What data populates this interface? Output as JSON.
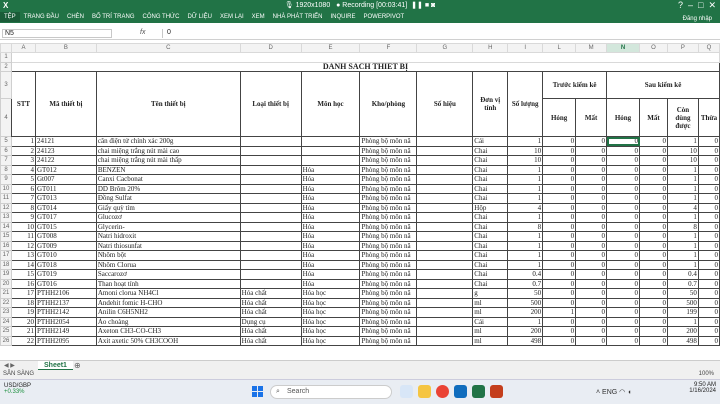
{
  "window": {
    "title": "Recording [00:03:41]",
    "resolution": "1920x1080",
    "app_logo": "X"
  },
  "ribbon": {
    "tabs": [
      "TỆP",
      "TRANG ĐẦU",
      "CHÈN",
      "BỐ TRÍ TRANG",
      "CÔNG THỨC",
      "DỮ LIỆU",
      "XEM LẠI",
      "XEM",
      "NHÀ PHÁT TRIỂN",
      "INQUIRE",
      "POWERPIVOT"
    ],
    "right": "Đăng nhập"
  },
  "formula": {
    "name_box": "N5",
    "fx": "fx",
    "value": "0"
  },
  "columns": [
    "A",
    "B",
    "C",
    "D",
    "E",
    "F",
    "G",
    "H",
    "I",
    "L",
    "M",
    "N",
    "O",
    "P",
    "Q"
  ],
  "selected_column": "N",
  "sheet": {
    "title": "DANH SÁCH THIẾT BỊ",
    "headers": {
      "stt": "STT",
      "code": "Mã thiết bị",
      "name": "Tên thiết bị",
      "type": "Loại thiết bị",
      "subject": "Môn học",
      "store": "Kho/phòng",
      "serial": "Số hiệu",
      "unit": "Đơn vị tính",
      "qty": "Số lượng",
      "before": "Trước kiểm kê",
      "after": "Sau kiểm kê",
      "damaged": "Hỏng",
      "lost": "Mất",
      "usable": "Còn dùng được",
      "excess": "Thừa"
    },
    "rows": [
      {
        "r": "5",
        "stt": "1",
        "code": "24121",
        "name": "cân điện tử chính xác 200g",
        "type": "",
        "subject": "",
        "store": "Phòng bộ môn nă",
        "unit": "Cái",
        "qty": "1",
        "l": "0",
        "m": "0",
        "n": "0",
        "o": "0",
        "p": "1",
        "q": "0"
      },
      {
        "r": "6",
        "stt": "2",
        "code": "24123",
        "name": "chai miệng trắng nút mài cao",
        "type": "",
        "subject": "",
        "store": "Phòng bộ môn nă",
        "unit": "Chai",
        "qty": "10",
        "l": "0",
        "m": "0",
        "n": "0",
        "o": "0",
        "p": "10",
        "q": "0"
      },
      {
        "r": "7",
        "stt": "3",
        "code": "24122",
        "name": "chai miệng trắng nút mài thấp",
        "type": "",
        "subject": "",
        "store": "Phòng bộ môn nă",
        "unit": "Chai",
        "qty": "10",
        "l": "0",
        "m": "0",
        "n": "0",
        "o": "0",
        "p": "10",
        "q": "0"
      },
      {
        "r": "8",
        "stt": "4",
        "code": "GT012",
        "name": "BENZEN",
        "type": "",
        "subject": "Hóa",
        "store": "Phòng bộ môn nă",
        "unit": "Chai",
        "qty": "1",
        "l": "0",
        "m": "0",
        "n": "0",
        "o": "0",
        "p": "1",
        "q": "0"
      },
      {
        "r": "9",
        "stt": "5",
        "code": "Gt007",
        "name": "Canxi Cacbonat",
        "type": "",
        "subject": "Hóa",
        "store": "Phòng bộ môn nă",
        "unit": "Chai",
        "qty": "1",
        "l": "0",
        "m": "0",
        "n": "0",
        "o": "0",
        "p": "1",
        "q": "0"
      },
      {
        "r": "10",
        "stt": "6",
        "code": "GT011",
        "name": "DD Brôm 20%",
        "type": "",
        "subject": "Hóa",
        "store": "Phòng bộ môn nă",
        "unit": "Chai",
        "qty": "1",
        "l": "0",
        "m": "0",
        "n": "0",
        "o": "0",
        "p": "1",
        "q": "0"
      },
      {
        "r": "11",
        "stt": "7",
        "code": "GT013",
        "name": "Đồng Sulfat",
        "type": "",
        "subject": "Hóa",
        "store": "Phòng bộ môn nă",
        "unit": "Chai",
        "qty": "1",
        "l": "0",
        "m": "0",
        "n": "0",
        "o": "0",
        "p": "1",
        "q": "0"
      },
      {
        "r": "12",
        "stt": "8",
        "code": "GT014",
        "name": "Giấy quỳ tím",
        "type": "",
        "subject": "Hóa",
        "store": "Phòng bộ môn nă",
        "unit": "Hộp",
        "qty": "4",
        "l": "0",
        "m": "0",
        "n": "0",
        "o": "0",
        "p": "4",
        "q": "0"
      },
      {
        "r": "13",
        "stt": "9",
        "code": "GT017",
        "name": "Glucozơ",
        "type": "",
        "subject": "Hóa",
        "store": "Phòng bộ môn nă",
        "unit": "Chai",
        "qty": "1",
        "l": "0",
        "m": "0",
        "n": "0",
        "o": "0",
        "p": "1",
        "q": "0"
      },
      {
        "r": "14",
        "stt": "10",
        "code": "GT015",
        "name": "Glycerin-",
        "type": "",
        "subject": "Hóa",
        "store": "Phòng bộ môn nă",
        "unit": "Chai",
        "qty": "8",
        "l": "0",
        "m": "0",
        "n": "0",
        "o": "0",
        "p": "8",
        "q": "0"
      },
      {
        "r": "15",
        "stt": "11",
        "code": "GT008",
        "name": "Natri hidroxit",
        "type": "",
        "subject": "Hóa",
        "store": "Phòng bộ môn nă",
        "unit": "Chai",
        "qty": "1",
        "l": "0",
        "m": "0",
        "n": "0",
        "o": "0",
        "p": "1",
        "q": "0"
      },
      {
        "r": "16",
        "stt": "12",
        "code": "GT009",
        "name": "Natri thiosunfat",
        "type": "",
        "subject": "Hóa",
        "store": "Phòng bộ môn nă",
        "unit": "Chai",
        "qty": "1",
        "l": "0",
        "m": "0",
        "n": "0",
        "o": "0",
        "p": "1",
        "q": "0"
      },
      {
        "r": "17",
        "stt": "13",
        "code": "GT010",
        "name": "Nhôm bột",
        "type": "",
        "subject": "Hóa",
        "store": "Phòng bộ môn nă",
        "unit": "Chai",
        "qty": "1",
        "l": "0",
        "m": "0",
        "n": "0",
        "o": "0",
        "p": "1",
        "q": "0"
      },
      {
        "r": "18",
        "stt": "14",
        "code": "GT018",
        "name": "Nhôm Clorua",
        "type": "",
        "subject": "Hóa",
        "store": "Phòng bộ môn nă",
        "unit": "Chai",
        "qty": "1",
        "l": "0",
        "m": "0",
        "n": "0",
        "o": "0",
        "p": "1",
        "q": "0"
      },
      {
        "r": "19",
        "stt": "15",
        "code": "GT019",
        "name": "Saccarozơ",
        "type": "",
        "subject": "Hóa",
        "store": "Phòng bộ môn nă",
        "unit": "Chai",
        "qty": "0.4",
        "l": "0",
        "m": "0",
        "n": "0",
        "o": "0",
        "p": "0.4",
        "q": "0"
      },
      {
        "r": "20",
        "stt": "16",
        "code": "GT016",
        "name": "Than hoạt tính",
        "type": "",
        "subject": "Hóa",
        "store": "Phòng bộ môn nă",
        "unit": "Chai",
        "qty": "0.7",
        "l": "0",
        "m": "0",
        "n": "0",
        "o": "0",
        "p": "0.7",
        "q": "0"
      },
      {
        "r": "21",
        "stt": "17",
        "code": "PTHH2106",
        "name": "Amoni clorua NH4Cl",
        "type": "Hóa chất",
        "subject": "Hóa học",
        "store": "Phòng bộ môn nă",
        "unit": "g",
        "qty": "50",
        "l": "0",
        "m": "0",
        "n": "0",
        "o": "0",
        "p": "50",
        "q": "0"
      },
      {
        "r": "22",
        "stt": "18",
        "code": "PTHH2137",
        "name": "Andehit fomic H-CHO",
        "type": "Hóa chất",
        "subject": "Hóa học",
        "store": "Phòng bộ môn nă",
        "unit": "ml",
        "qty": "500",
        "l": "0",
        "m": "0",
        "n": "0",
        "o": "0",
        "p": "500",
        "q": "0"
      },
      {
        "r": "23",
        "stt": "19",
        "code": "PTHH2142",
        "name": "Anilin C6H5NH2",
        "type": "Hóa chất",
        "subject": "Hóa học",
        "store": "Phòng bộ môn nă",
        "unit": "ml",
        "qty": "200",
        "l": "1",
        "m": "0",
        "n": "0",
        "o": "0",
        "p": "199",
        "q": "0"
      },
      {
        "r": "24",
        "stt": "20",
        "code": "PTHH2054",
        "name": "Áo choàng",
        "type": "Dụng cụ",
        "subject": "Hóa học",
        "store": "Phòng bộ môn nă",
        "unit": "Cái",
        "qty": "1",
        "l": "0",
        "m": "0",
        "n": "0",
        "o": "0",
        "p": "1",
        "q": "0"
      },
      {
        "r": "25",
        "stt": "21",
        "code": "PTHH2149",
        "name": "Axeton CH3-CO-CH3",
        "type": "Hóa chất",
        "subject": "Hóa học",
        "store": "Phòng bộ môn nă",
        "unit": "ml",
        "qty": "200",
        "l": "0",
        "m": "0",
        "n": "0",
        "o": "0",
        "p": "200",
        "q": "0"
      },
      {
        "r": "26",
        "stt": "22",
        "code": "PTHH2095",
        "name": "Axit axetic 50% CH3COOH",
        "type": "Hóa chất",
        "subject": "Hóa học",
        "store": "Phòng bộ môn nă",
        "unit": "ml",
        "qty": "498",
        "l": "0",
        "m": "0",
        "n": "0",
        "o": "0",
        "p": "498",
        "q": "0"
      }
    ]
  },
  "tabs": {
    "sheet": "Sheet1"
  },
  "status": {
    "left": "SẴN SÀNG",
    "zoom": "100%"
  },
  "taskbar": {
    "weather_title": "USD/GBP",
    "weather_value": "+0.33%",
    "search": "Search",
    "lang": "ENG",
    "time": "9:50 AM",
    "date": "1/16/2024"
  },
  "colors": {
    "excel_green": "#217346"
  }
}
